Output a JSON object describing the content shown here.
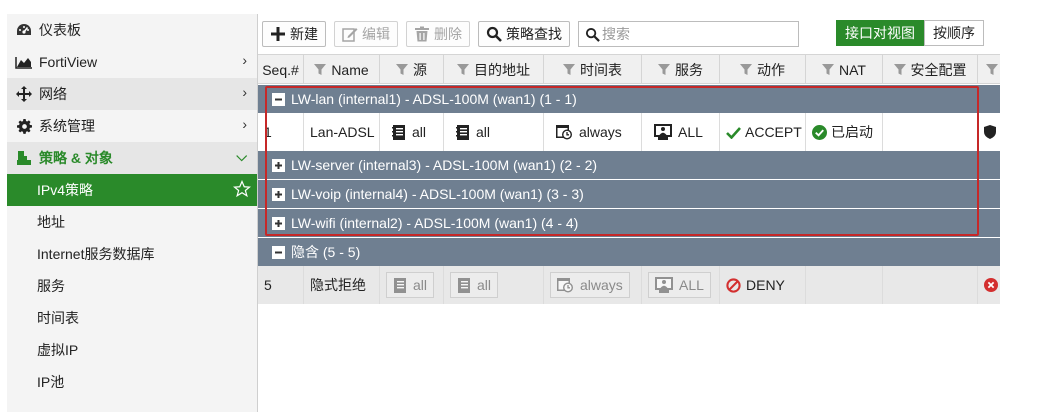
{
  "sidebar": {
    "items": [
      {
        "label": "仪表板",
        "icon": "dashboard-icon"
      },
      {
        "label": "FortiView",
        "icon": "chart-icon"
      },
      {
        "label": "网络",
        "icon": "move-icon"
      },
      {
        "label": "系统管理",
        "icon": "gear-icon"
      },
      {
        "label": "策略 & 对象",
        "icon": "policy-icon"
      },
      {
        "label": "IPv4策略"
      },
      {
        "label": "地址"
      },
      {
        "label": "Internet服务数据库"
      },
      {
        "label": "服务"
      },
      {
        "label": "时间表"
      },
      {
        "label": "虚拟IP"
      },
      {
        "label": "IP池"
      }
    ]
  },
  "toolbar": {
    "new_label": "新建",
    "edit_label": "编辑",
    "delete_label": "删除",
    "lookup_label": "策略查找",
    "search_placeholder": "搜索",
    "view_interface": "接口对视图",
    "view_sequence": "按顺序"
  },
  "table": {
    "columns": [
      "Seq.#",
      "Name",
      "源",
      "目的地址",
      "时间表",
      "服务",
      "动作",
      "NAT",
      "安全配置"
    ],
    "groups": [
      {
        "label": "LW-lan (internal1) - ADSL-100M (wan1) (1 - 1)",
        "expanded": true
      },
      {
        "label": "LW-server (internal3) - ADSL-100M (wan1) (2 - 2)",
        "expanded": false
      },
      {
        "label": "LW-voip (internal4) - ADSL-100M (wan1) (3 - 3)",
        "expanded": false
      },
      {
        "label": "LW-wifi (internal2) - ADSL-100M (wan1) (4 - 4)",
        "expanded": false
      },
      {
        "label": "隐含 (5 - 5)",
        "expanded": true
      }
    ],
    "rows": [
      {
        "seq": "1",
        "name": "Lan-ADSL",
        "src": "all",
        "dst": "all",
        "schedule": "always",
        "service": "ALL",
        "action": "ACCEPT",
        "nat": "已启动"
      },
      {
        "seq": "5",
        "name": "隐式拒绝",
        "src": "all",
        "dst": "all",
        "schedule": "always",
        "service": "ALL",
        "action": "DENY",
        "nat": ""
      }
    ]
  },
  "colors": {
    "accent": "#2a8a2a",
    "group_row": "#6f7f91",
    "highlight": "#c62828",
    "deny": "#d32f2f"
  }
}
